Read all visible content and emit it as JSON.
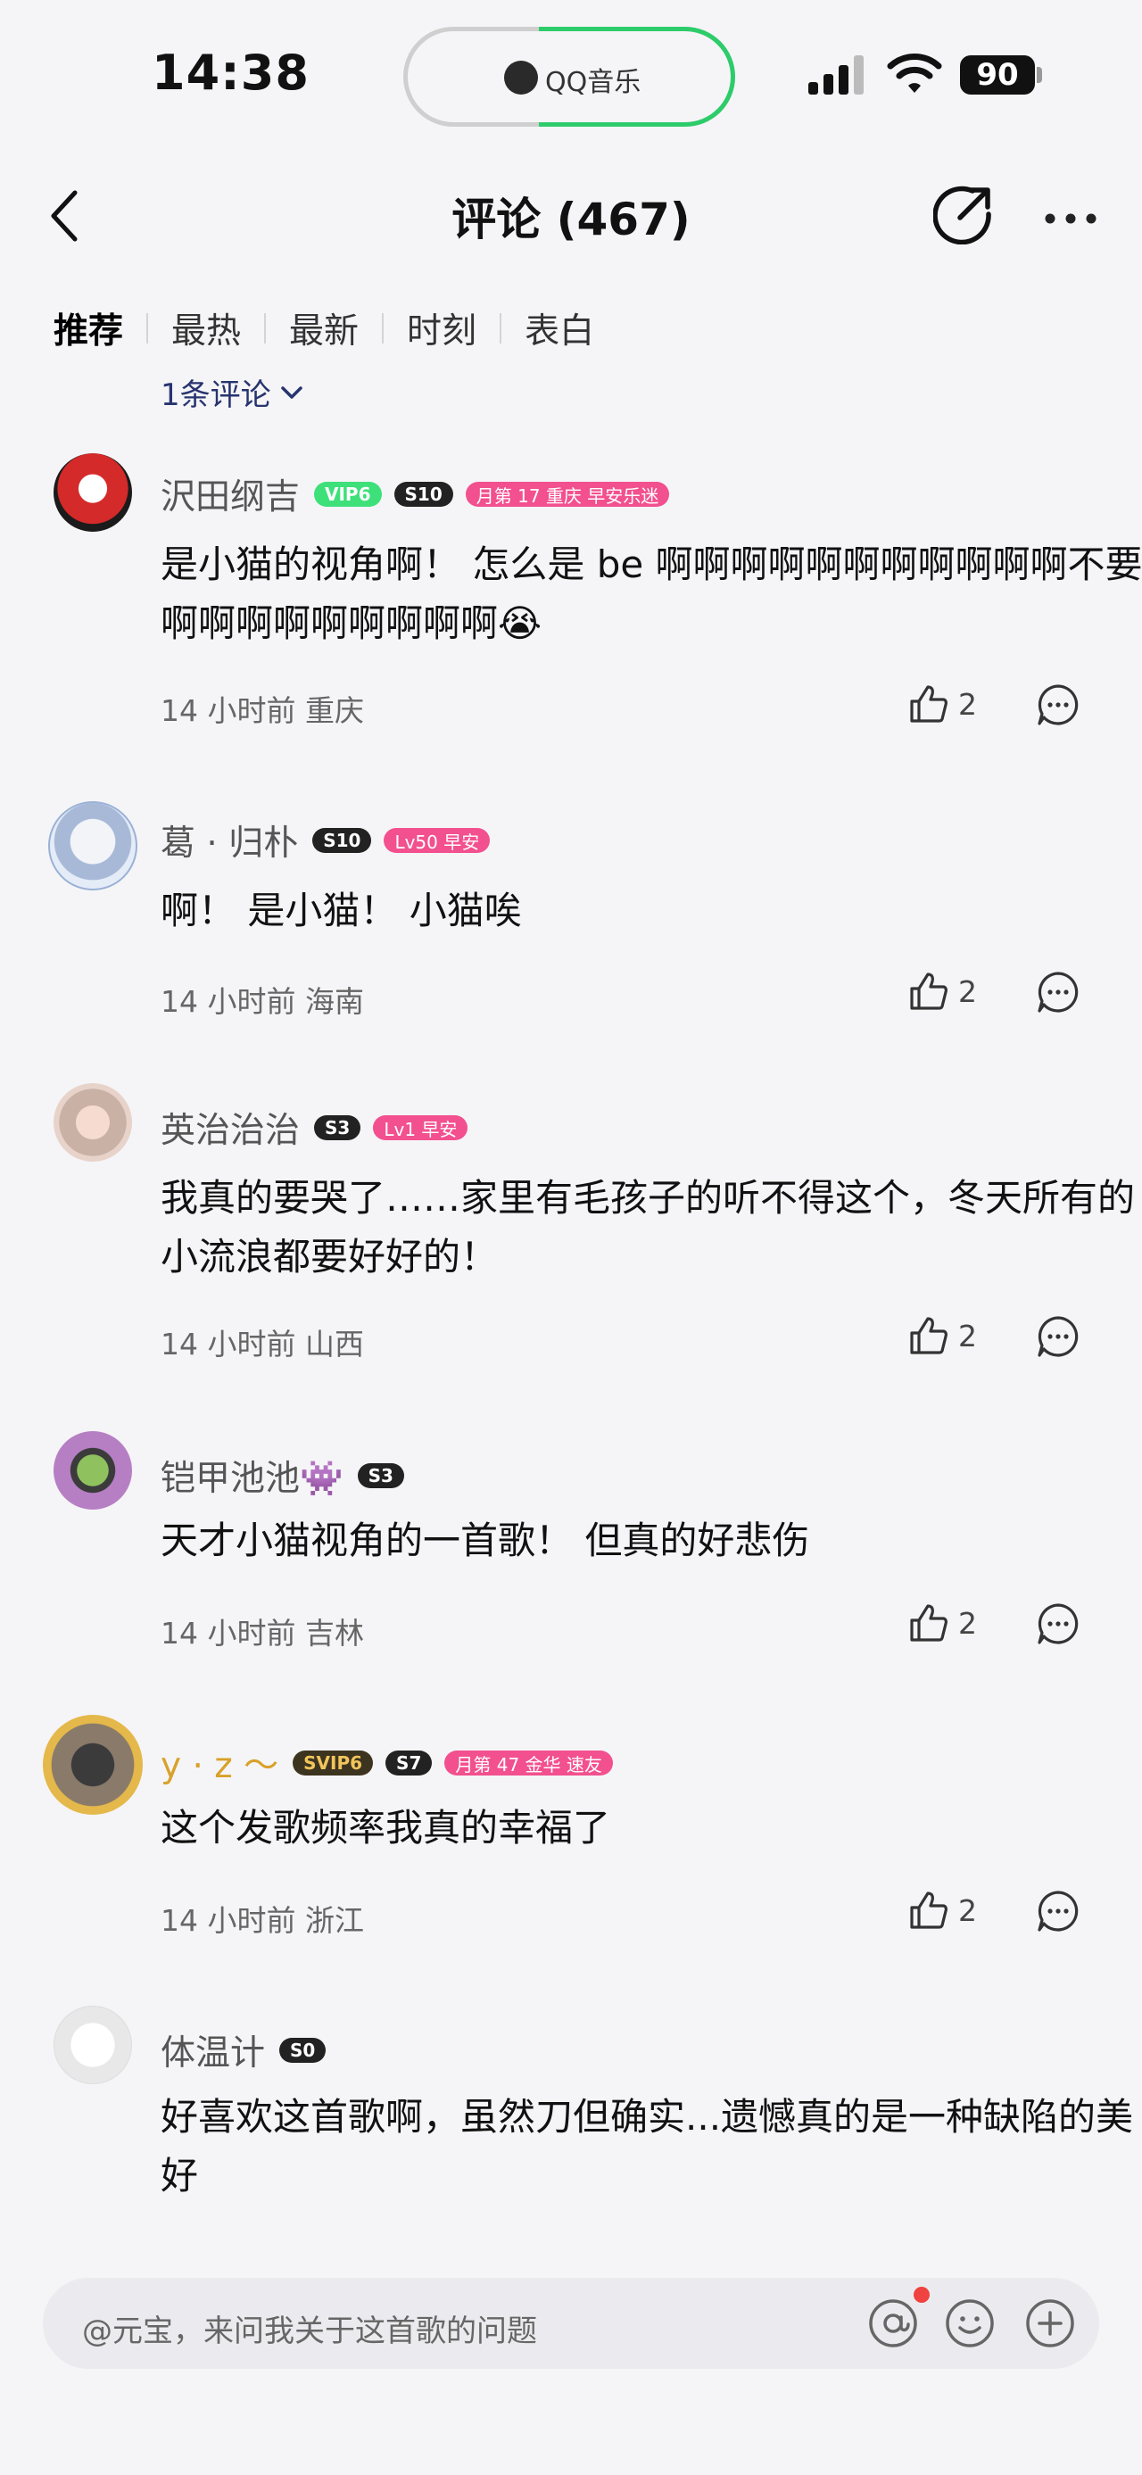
{
  "status_bar": {
    "time": "14:38",
    "island_app": "QQ音乐",
    "battery": "90"
  },
  "header": {
    "title": "评论 (467)"
  },
  "tabs": [
    "推荐",
    "最热",
    "最新",
    "时刻",
    "表白"
  ],
  "filter": {
    "count_label": "1条评论"
  },
  "comments": [
    {
      "name": "沢田纲吉",
      "badges": {
        "vip": "VIP6",
        "s": "S10",
        "pink": "月第 17 重庆 早安乐迷"
      },
      "text": "是小猫的视角啊！ 怎么是 be 啊啊啊啊啊啊啊啊啊啊啊不要啊啊啊啊啊啊啊啊啊😭",
      "time": "14 小时前",
      "location": "重庆",
      "likes": "2"
    },
    {
      "name": "葛 · 归朴",
      "badges": {
        "s": "S10",
        "pink": "Lv50 早安"
      },
      "text": "啊！ 是小猫！ 小猫唉",
      "time": "14 小时前",
      "location": "海南",
      "likes": "2"
    },
    {
      "name": "英治治治",
      "badges": {
        "s": "S3",
        "pink": "Lv1 早安"
      },
      "text": "我真的要哭了……家里有毛孩子的听不得这个，冬天所有的小流浪都要好好的！",
      "time": "14 小时前",
      "location": "山西",
      "likes": "2"
    },
    {
      "name": "铠甲池池👾",
      "badges": {
        "s": "S3"
      },
      "text": "天才小猫视角的一首歌！ 但真的好悲伤",
      "time": "14 小时前",
      "location": "吉林",
      "likes": "2"
    },
    {
      "name": "y · z ～",
      "badges": {
        "svip": "SVIP6",
        "s": "S7",
        "pink": "月第 47 金华 速友"
      },
      "text": "这个发歌频率我真的幸福了",
      "time": "14 小时前",
      "location": "浙江",
      "likes": "2"
    },
    {
      "name": "体温计",
      "badges": {
        "s": "S0"
      },
      "text": "好喜欢这首歌啊，虽然刀但确实...遗憾真的是一种缺陷的美好"
    }
  ],
  "input": {
    "placeholder": "@元宝，来问我关于这首歌的问题"
  },
  "colors": {
    "accent_green": "#2dcc6a",
    "vip_green": "#3ee07a",
    "pink_badge": "#f2508f",
    "filter_blue": "#27346f"
  }
}
